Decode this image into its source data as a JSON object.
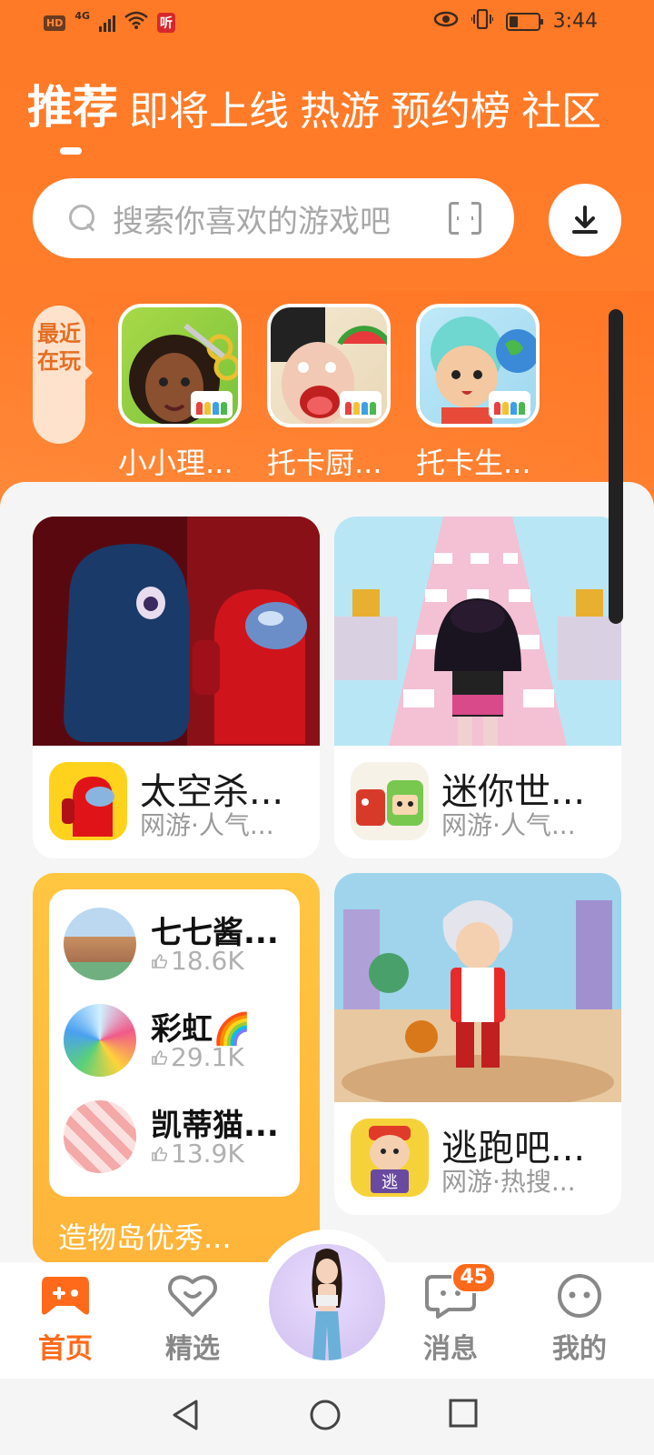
{
  "status_bar": {
    "hd": "HD",
    "network": "4G",
    "app_badge": "听",
    "time": "3:44"
  },
  "tabs": [
    {
      "label": "推荐",
      "active": true
    },
    {
      "label": "即将上线",
      "active": false
    },
    {
      "label": "热游",
      "active": false
    },
    {
      "label": "预约榜",
      "active": false
    },
    {
      "label": "社区",
      "active": false
    }
  ],
  "search": {
    "placeholder": "搜索你喜欢的游戏吧"
  },
  "recent": {
    "label": "最近在玩",
    "items": [
      {
        "name": "小小理...",
        "icon": "toca-hair-salon-icon"
      },
      {
        "name": "托卡厨...",
        "icon": "toca-kitchen-icon"
      },
      {
        "name": "托卡生...",
        "icon": "toca-life-icon"
      }
    ]
  },
  "cards": [
    {
      "name": "太空杀...",
      "sub": "网游·人气...",
      "icon": "among-us-icon"
    },
    {
      "name": "迷你世...",
      "sub": "网游·人气...",
      "icon": "mini-world-icon"
    },
    {
      "name": "逃跑吧...",
      "sub": "网游·热搜...",
      "icon": "escape-game-icon"
    }
  ],
  "collection": {
    "rows": [
      {
        "title": "七七酱...",
        "likes": "18.6K"
      },
      {
        "title": "彩虹🌈",
        "likes": "29.1K"
      },
      {
        "title": "凯蒂猫...",
        "likes": "13.9K"
      }
    ],
    "title": "造物岛优秀..."
  },
  "bottom_nav": [
    {
      "label": "首页",
      "icon": "gamepad-icon",
      "active": true
    },
    {
      "label": "精选",
      "icon": "heart-bubble-icon",
      "active": false
    },
    {
      "label": "消息",
      "icon": "chat-icon",
      "active": false,
      "badge": "45"
    },
    {
      "label": "我的",
      "icon": "face-icon",
      "active": false
    }
  ],
  "colors": {
    "brand": "#ff7a26",
    "active_nav": "#ff6a1a",
    "collection": "#ffbe3c"
  }
}
